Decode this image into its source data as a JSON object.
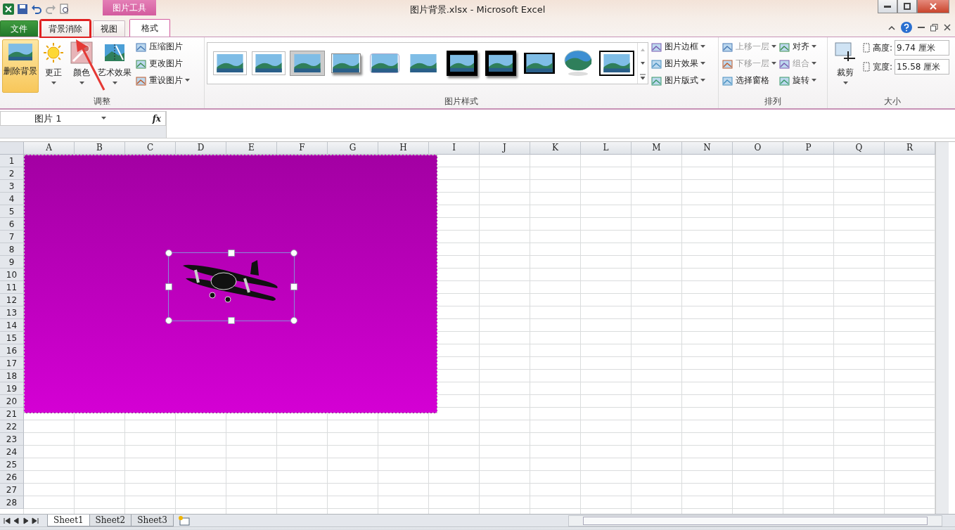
{
  "window": {
    "title": "图片背景.xlsx - Microsoft Excel",
    "context_group": "图片工具"
  },
  "tabs": [
    {
      "label": "文件",
      "kind": "file",
      "selected": false,
      "highlighted": false
    },
    {
      "label": "背景消除",
      "kind": "normal",
      "selected": false,
      "highlighted": true
    },
    {
      "label": "视图",
      "kind": "normal",
      "selected": false,
      "highlighted": false
    },
    {
      "label": "格式",
      "kind": "context",
      "selected": true,
      "highlighted": false
    }
  ],
  "ribbon": {
    "adjust": {
      "title": "调整",
      "big_buttons": [
        {
          "label": "删除背景",
          "kind": "remove",
          "selected": true,
          "dropdown": false
        },
        {
          "label": "更正",
          "kind": "sun",
          "selected": false,
          "dropdown": true
        },
        {
          "label": "颜色",
          "kind": "color",
          "selected": false,
          "dropdown": true
        },
        {
          "label": "艺术效果",
          "kind": "art",
          "selected": false,
          "dropdown": true
        }
      ],
      "small_buttons": [
        {
          "label": "压缩图片",
          "dropdown": false
        },
        {
          "label": "更改图片",
          "dropdown": false
        },
        {
          "label": "重设图片",
          "dropdown": true
        }
      ]
    },
    "styles": {
      "title": "图片样式",
      "thumbnails": [
        {
          "kind": "white"
        },
        {
          "kind": "white"
        },
        {
          "kind": "grey"
        },
        {
          "kind": "shadow"
        },
        {
          "kind": "rounded"
        },
        {
          "kind": "soft"
        },
        {
          "kind": "black"
        },
        {
          "kind": "black"
        },
        {
          "kind": "thin"
        },
        {
          "kind": "oval"
        },
        {
          "kind": "double"
        }
      ],
      "commands": [
        {
          "label": "图片边框"
        },
        {
          "label": "图片效果"
        },
        {
          "label": "图片版式"
        }
      ]
    },
    "arrange": {
      "title": "排列",
      "commands": [
        {
          "label": "上移一层",
          "disabled": true
        },
        {
          "label": "对齐",
          "disabled": false
        },
        {
          "label": "下移一层",
          "disabled": true
        },
        {
          "label": "组合",
          "disabled": true
        },
        {
          "label": "选择窗格",
          "disabled": false,
          "dropdown": false
        },
        {
          "label": "旋转",
          "disabled": false
        }
      ]
    },
    "size": {
      "title": "大小",
      "crop": "裁剪",
      "fields": [
        {
          "label": "高度:",
          "value": "9.74 厘米"
        },
        {
          "label": "宽度:",
          "value": "15.58 厘米"
        }
      ]
    }
  },
  "formula_bar": {
    "name_box": "图片 1",
    "fx": "fx"
  },
  "sheet": {
    "columns": [
      "A",
      "B",
      "C",
      "D",
      "E",
      "F",
      "G",
      "H",
      "I",
      "J",
      "K",
      "L",
      "M",
      "N",
      "O",
      "P",
      "Q",
      "R"
    ],
    "rows": [
      "1",
      "2",
      "3",
      "4",
      "5",
      "6",
      "7",
      "8",
      "9",
      "10",
      "11",
      "12",
      "13",
      "14",
      "15",
      "16",
      "17",
      "18",
      "19",
      "20",
      "21",
      "22",
      "23",
      "24",
      "25",
      "26",
      "27",
      "28"
    ]
  },
  "sheets": [
    {
      "label": "Sheet1",
      "selected": true
    },
    {
      "label": "Sheet2",
      "selected": false
    },
    {
      "label": "Sheet3",
      "selected": false
    }
  ]
}
